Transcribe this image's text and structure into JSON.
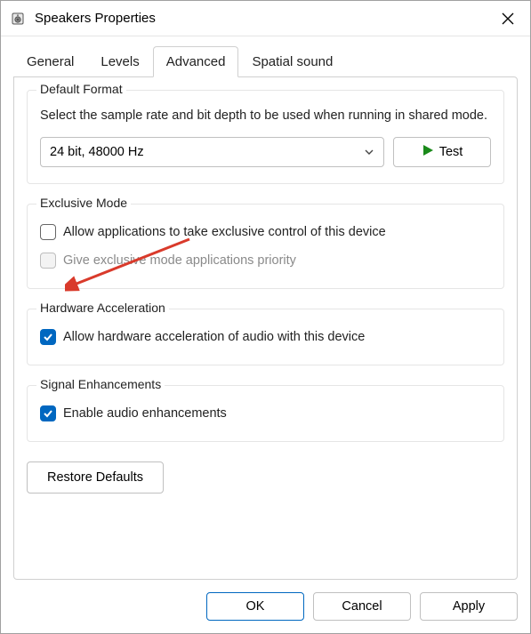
{
  "window": {
    "title": "Speakers Properties"
  },
  "tabs": {
    "general": "General",
    "levels": "Levels",
    "advanced": "Advanced",
    "spatial": "Spatial sound",
    "active": "advanced"
  },
  "default_format": {
    "legend": "Default Format",
    "desc": "Select the sample rate and bit depth to be used when running in shared mode.",
    "selected": "24 bit, 48000 Hz",
    "test_label": "Test"
  },
  "exclusive_mode": {
    "legend": "Exclusive Mode",
    "allow_exclusive": {
      "label": "Allow applications to take exclusive control of this device",
      "checked": false
    },
    "priority": {
      "label": "Give exclusive mode applications priority",
      "checked": false,
      "disabled": true
    }
  },
  "hardware_accel": {
    "legend": "Hardware Acceleration",
    "allow": {
      "label": "Allow hardware acceleration of audio with this device",
      "checked": true
    }
  },
  "signal": {
    "legend": "Signal Enhancements",
    "enable": {
      "label": "Enable audio enhancements",
      "checked": true
    }
  },
  "restore_defaults": "Restore Defaults",
  "buttons": {
    "ok": "OK",
    "cancel": "Cancel",
    "apply": "Apply"
  }
}
